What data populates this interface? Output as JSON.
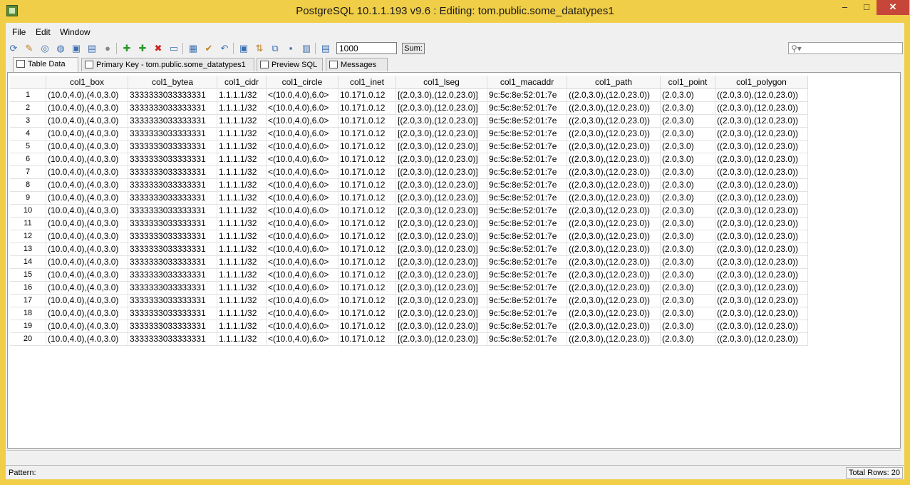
{
  "window": {
    "title": "PostgreSQL 10.1.1.193 v9.6 : Editing: tom.public.some_datatypes1",
    "min_glyph": "–",
    "max_glyph": "□",
    "close_glyph": "✕"
  },
  "menu": {
    "file": "File",
    "edit": "Edit",
    "window": "Window"
  },
  "toolbar": {
    "limit_value": "1000",
    "sum_label": "Sum:"
  },
  "tabs": {
    "table_data": "Table Data",
    "primary_key": "Primary Key - tom.public.some_datatypes1",
    "preview_sql": "Preview SQL",
    "messages": "Messages"
  },
  "grid": {
    "columns": [
      "",
      "col1_box",
      "col1_bytea",
      "col1_cidr",
      "col1_circle",
      "col1_inet",
      "col1_lseg",
      "col1_macaddr",
      "col1_path",
      "col1_point",
      "col1_polygon"
    ],
    "row_values": [
      "(10.0,4.0),(4.0,3.0)",
      "3333333033333331",
      "1.1.1.1/32",
      "<(10.0,4.0),6.0>",
      "10.171.0.12",
      "[(2.0,3.0),(12.0,23.0)]",
      "9c:5c:8e:52:01:7e",
      "((2.0,3.0),(12.0,23.0))",
      "(2.0,3.0)",
      "((2.0,3.0),(12.0,23.0))"
    ],
    "row_count": 20
  },
  "status": {
    "pattern_label": "Pattern:",
    "total_rows": "Total Rows: 20"
  }
}
